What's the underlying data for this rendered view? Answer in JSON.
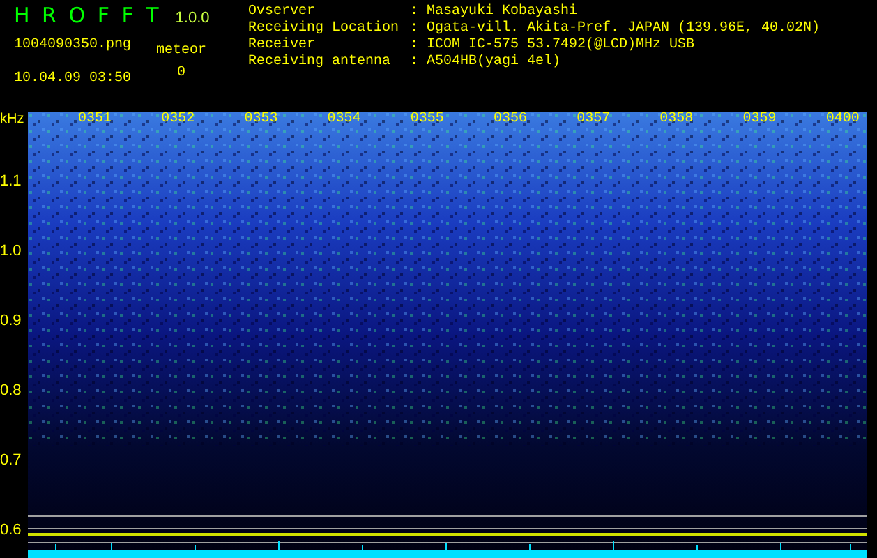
{
  "app": {
    "title": "H R O F F T",
    "version": "1.0.0",
    "filename": "1004090350.png",
    "timestamp": "10.04.09 03:50",
    "meteor_label": "meteor",
    "meteor_count": "0"
  },
  "info": [
    {
      "label": "Ovserver",
      "separator": ":",
      "value": "Masayuki Kobayashi"
    },
    {
      "label": "Receiving Location",
      "separator": ":",
      "value": "Ogata-vill. Akita-Pref. JAPAN (139.96E, 40.02N)"
    },
    {
      "label": "Receiver",
      "separator": ":",
      "value": "ICOM IC-575 53.7492(@LCD)MHz USB"
    },
    {
      "label": "Receiving antenna",
      "separator": ":",
      "value": "A504HB(yagi 4el)"
    }
  ],
  "spectrogram": {
    "unit": "kHz",
    "frequency_labels": [
      "1.1",
      "1.0",
      "0.9",
      "0.8",
      "0.7",
      "0.6"
    ],
    "time_labels": [
      "0351",
      "0352",
      "0353",
      "0354",
      "0355",
      "0356",
      "0357",
      "0358",
      "0359",
      "0400"
    ]
  }
}
